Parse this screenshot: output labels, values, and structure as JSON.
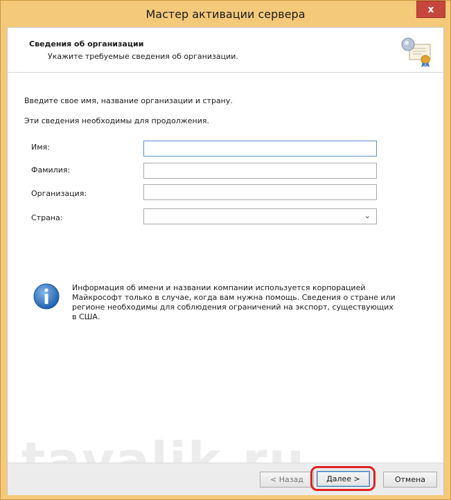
{
  "window": {
    "title": "Мастер активации сервера",
    "close_label": "x"
  },
  "header": {
    "title": "Сведения об организации",
    "subtitle": "Укажите требуемые сведения об организации."
  },
  "intro": {
    "line1": "Введите свое имя, название организации и страну.",
    "line2": "Эти сведения необходимы для продолжения."
  },
  "form": {
    "first_name": {
      "label": "Имя:",
      "value": ""
    },
    "last_name": {
      "label": "Фамилия:",
      "value": ""
    },
    "organization": {
      "label": "Организация:",
      "value": ""
    },
    "country": {
      "label": "Страна:",
      "value": ""
    }
  },
  "info": {
    "text": "Информация об имени и названии компании используется корпорацией Майкрософт только в случае, когда вам нужна помощь. Сведения о стране или регионе необходимы для соблюдения ограничений на экспорт, существующих в США."
  },
  "watermark": "tavalik.ru",
  "footer": {
    "back_label": "< Назад",
    "next_label": "Далее >",
    "cancel_label": "Отмена"
  },
  "colors": {
    "title_bar": "#f4c97a",
    "close_button": "#c7463c",
    "highlight": "#e02020"
  },
  "icons": {
    "header": "certificate-icon",
    "info": "info-icon",
    "dropdown": "chevron-down-icon"
  }
}
